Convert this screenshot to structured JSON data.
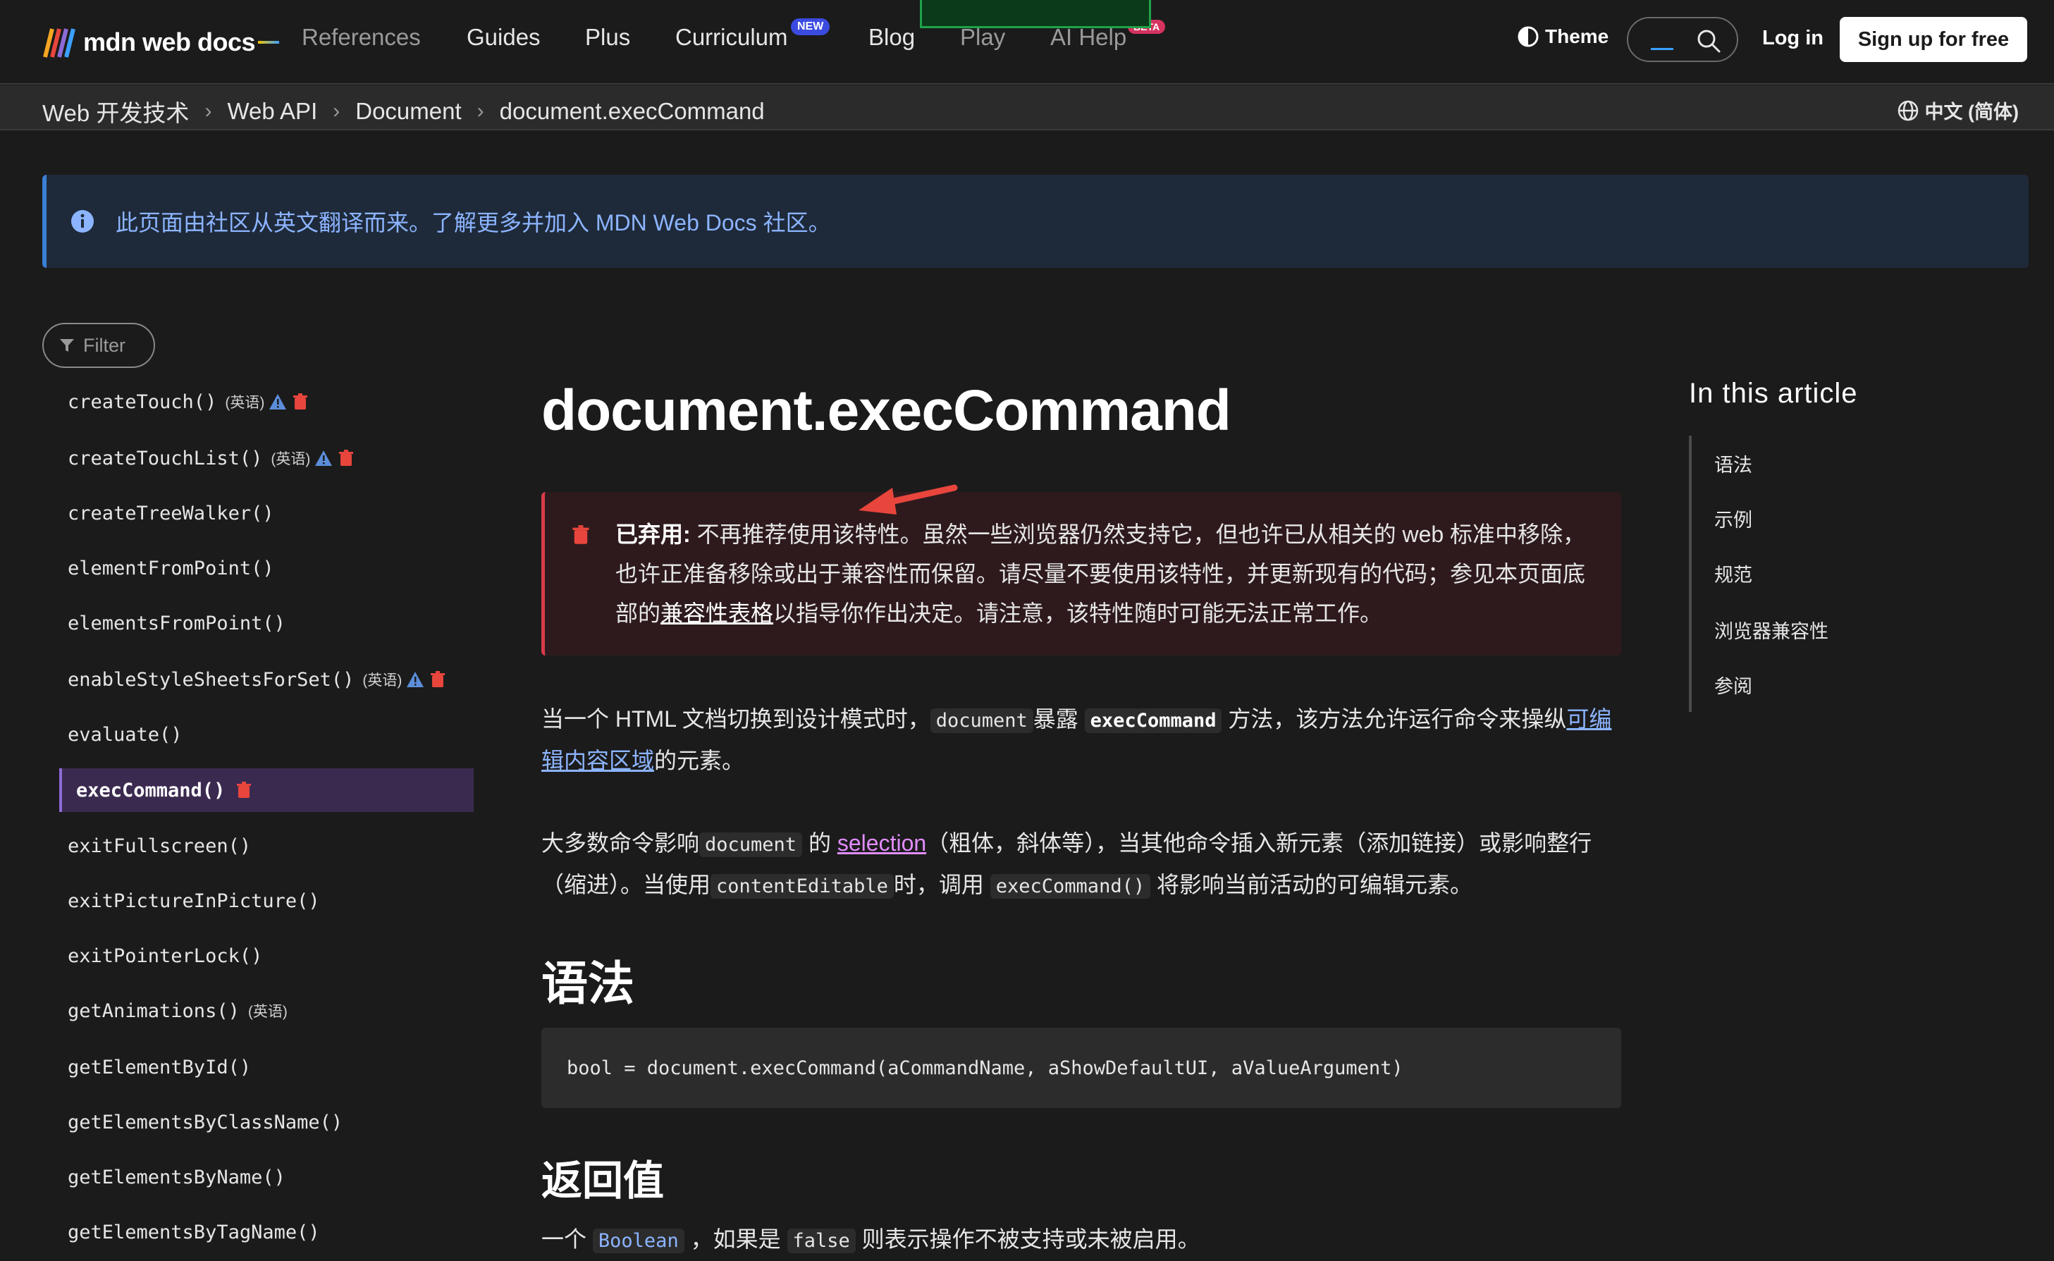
{
  "header": {
    "logo_text": "mdn web docs",
    "nav": [
      "References",
      "Guides",
      "Plus",
      "Curriculum",
      "Blog",
      "Play",
      "AI Help"
    ],
    "curriculum_badge": "NEW",
    "ai_badge": "BETA",
    "theme_label": "Theme",
    "login_label": "Log in",
    "signup_label": "Sign up for free"
  },
  "breadcrumb": [
    "Web 开发技术",
    "Web API",
    "Document",
    "document.execCommand"
  ],
  "language": "中文 (简体)",
  "notice": "此页面由社区从英文翻译而来。了解更多并加入 MDN Web Docs 社区。",
  "sidebar": {
    "filter_placeholder": "Filter",
    "items": [
      {
        "label": "createTouch()",
        "note": "(英语)"
      },
      {
        "label": "createTouchList()",
        "note": "(英语)"
      },
      {
        "label": "createTreeWalker()"
      },
      {
        "label": "elementFromPoint()"
      },
      {
        "label": "elementsFromPoint()"
      },
      {
        "label": "enableStyleSheetsForSet()",
        "note": "(英语)"
      },
      {
        "label": "evaluate()"
      },
      {
        "label": "execCommand()"
      },
      {
        "label": "exitFullscreen()"
      },
      {
        "label": "exitPictureInPicture()"
      },
      {
        "label": "exitPointerLock()"
      },
      {
        "label": "getAnimations()",
        "note": "(英语)"
      },
      {
        "label": "getElementById()"
      },
      {
        "label": "getElementsByClassName()"
      },
      {
        "label": "getElementsByName()"
      },
      {
        "label": "getElementsByTagName()"
      }
    ]
  },
  "article": {
    "title": "document.execCommand",
    "deprecated": {
      "label": "已弃用:",
      "text1": " 不再推荐使用该特性。虽然一些浏览器仍然支持它，但也许已从相关的 web 标准中移除，也许正准备移除或出于兼容性而保留。请尽量不要使用该特性，并更新现有的代码；参见本页面底部的",
      "link": "兼容性表格",
      "text2": "以指导你作出决定。请注意，该特性随时可能无法正常工作。"
    },
    "p1": {
      "a": "当一个 HTML 文档切换到设计模式时，",
      "code1": "document",
      "b": "暴露 ",
      "code2": "execCommand",
      "c": " 方法，该方法允许运行命令来操纵",
      "link": "可编辑内容区域",
      "d": "的元素。"
    },
    "p2": {
      "a": "大多数命令影响",
      "code1": "document",
      "b": " 的 ",
      "link": "selection",
      "c": "（粗体，斜体等），当其他命令插入新元素（添加链接）或影响整行（缩进）。当使用",
      "code2": "contentEditable",
      "d": "时，调用 ",
      "code3": "execCommand()",
      "e": " 将影响当前活动的可编辑元素。"
    },
    "h2_syntax": "语法",
    "syntax_code": "bool = document.execCommand(aCommandName, aShowDefaultUI, aValueArgument)",
    "h3_return": "返回值",
    "p3": {
      "a": "一个 ",
      "code1": "Boolean",
      "b": " ，如果是 ",
      "code2": "false",
      "c": " 则表示操作不被支持或未被启用。"
    }
  },
  "toc": {
    "title": "In this article",
    "items": [
      "语法",
      "示例",
      "规范",
      "浏览器兼容性",
      "参阅"
    ]
  },
  "colors": {
    "background": "#1b1b1b",
    "notice_accent": "#3a7fd5",
    "deprecated_accent": "#d93a4a",
    "active_item": "#3b2a50",
    "link": "#8cb4ff",
    "annotation_arrow": "#e8453c"
  }
}
